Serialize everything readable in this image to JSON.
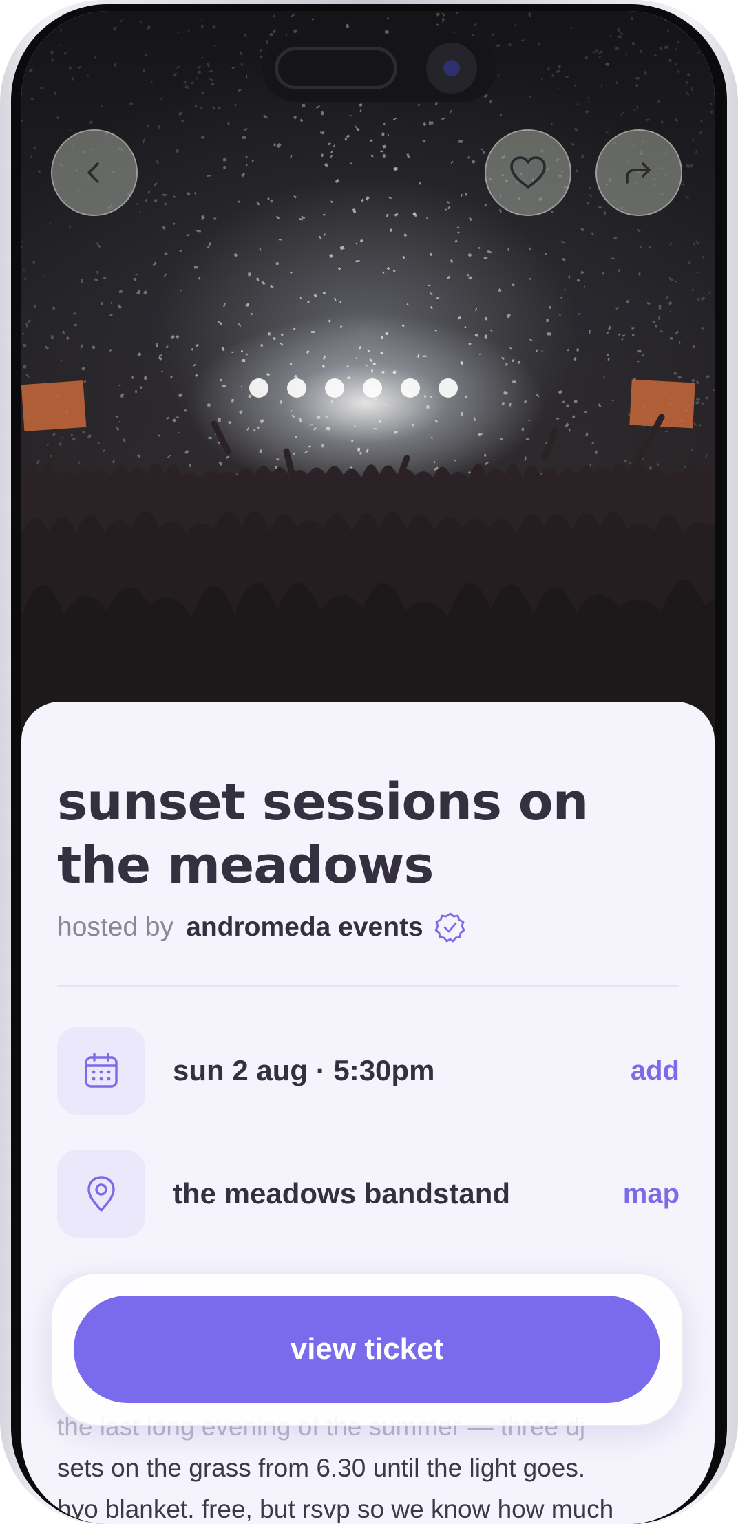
{
  "header": {
    "back_icon": "chevron-left-icon",
    "favorite_icon": "heart-icon",
    "share_icon": "share-arrow-icon"
  },
  "event": {
    "title": "sunset sessions on the meadows",
    "hosted_by_label": "hosted by",
    "host_name": "andromeda events",
    "host_verified_icon": "verified-badge-icon"
  },
  "details": [
    {
      "icon": "calendar-icon",
      "text": "sun 2 aug · 5:30pm",
      "action": "add"
    },
    {
      "icon": "map-pin-icon",
      "text": "the meadows bandstand",
      "action": "map"
    }
  ],
  "description": {
    "line1": "the last long evening of the summer — three dj",
    "line2": "sets on the grass from 6.30 until the light goes.",
    "line3": "byo blanket. free, but rsvp so we know how much"
  },
  "cta": {
    "label": "view ticket"
  },
  "colors": {
    "accent": "#7a6bec",
    "text_dark": "#35303f",
    "text_muted": "#8b8794",
    "sheet_bg": "#f5f3fb",
    "icon_tile_bg": "#ece8fb"
  }
}
